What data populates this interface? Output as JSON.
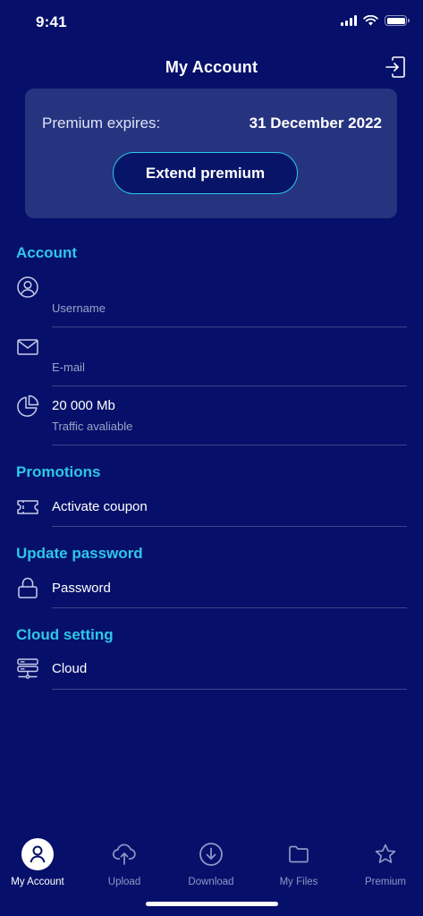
{
  "status_bar": {
    "time": "9:41"
  },
  "header": {
    "title": "My Account",
    "logout_icon": "logout-icon"
  },
  "premium": {
    "label": "Premium expires:",
    "date": "31 December 2022",
    "button_label": "Extend premium"
  },
  "sections": {
    "account": {
      "title": "Account",
      "username": {
        "value": "",
        "label": "Username",
        "icon": "user-icon"
      },
      "email": {
        "value": "",
        "label": "E-mail",
        "icon": "mail-icon"
      },
      "traffic": {
        "value": "20 000 Mb",
        "label": "Traffic avaliable",
        "icon": "pie-chart-icon"
      }
    },
    "promotions": {
      "title": "Promotions",
      "item": {
        "label": "Activate coupon",
        "icon": "ticket-icon"
      }
    },
    "password": {
      "title": "Update password",
      "item": {
        "label": "Password",
        "icon": "lock-icon"
      }
    },
    "cloud": {
      "title": "Cloud setting",
      "item": {
        "label": "Cloud",
        "icon": "server-icon"
      }
    }
  },
  "tabs": [
    {
      "label": "My Account",
      "icon": "user-icon",
      "active": true
    },
    {
      "label": "Upload",
      "icon": "cloud-upload-icon",
      "active": false
    },
    {
      "label": "Download",
      "icon": "download-icon",
      "active": false
    },
    {
      "label": "My Files",
      "icon": "folder-icon",
      "active": false
    },
    {
      "label": "Premium",
      "icon": "star-icon",
      "active": false
    }
  ],
  "colors": {
    "background": "#06106a",
    "card": "#263480",
    "accent": "#2fc6e8",
    "secondary_text": "#9aa3c9",
    "divider": "#3a4688"
  }
}
